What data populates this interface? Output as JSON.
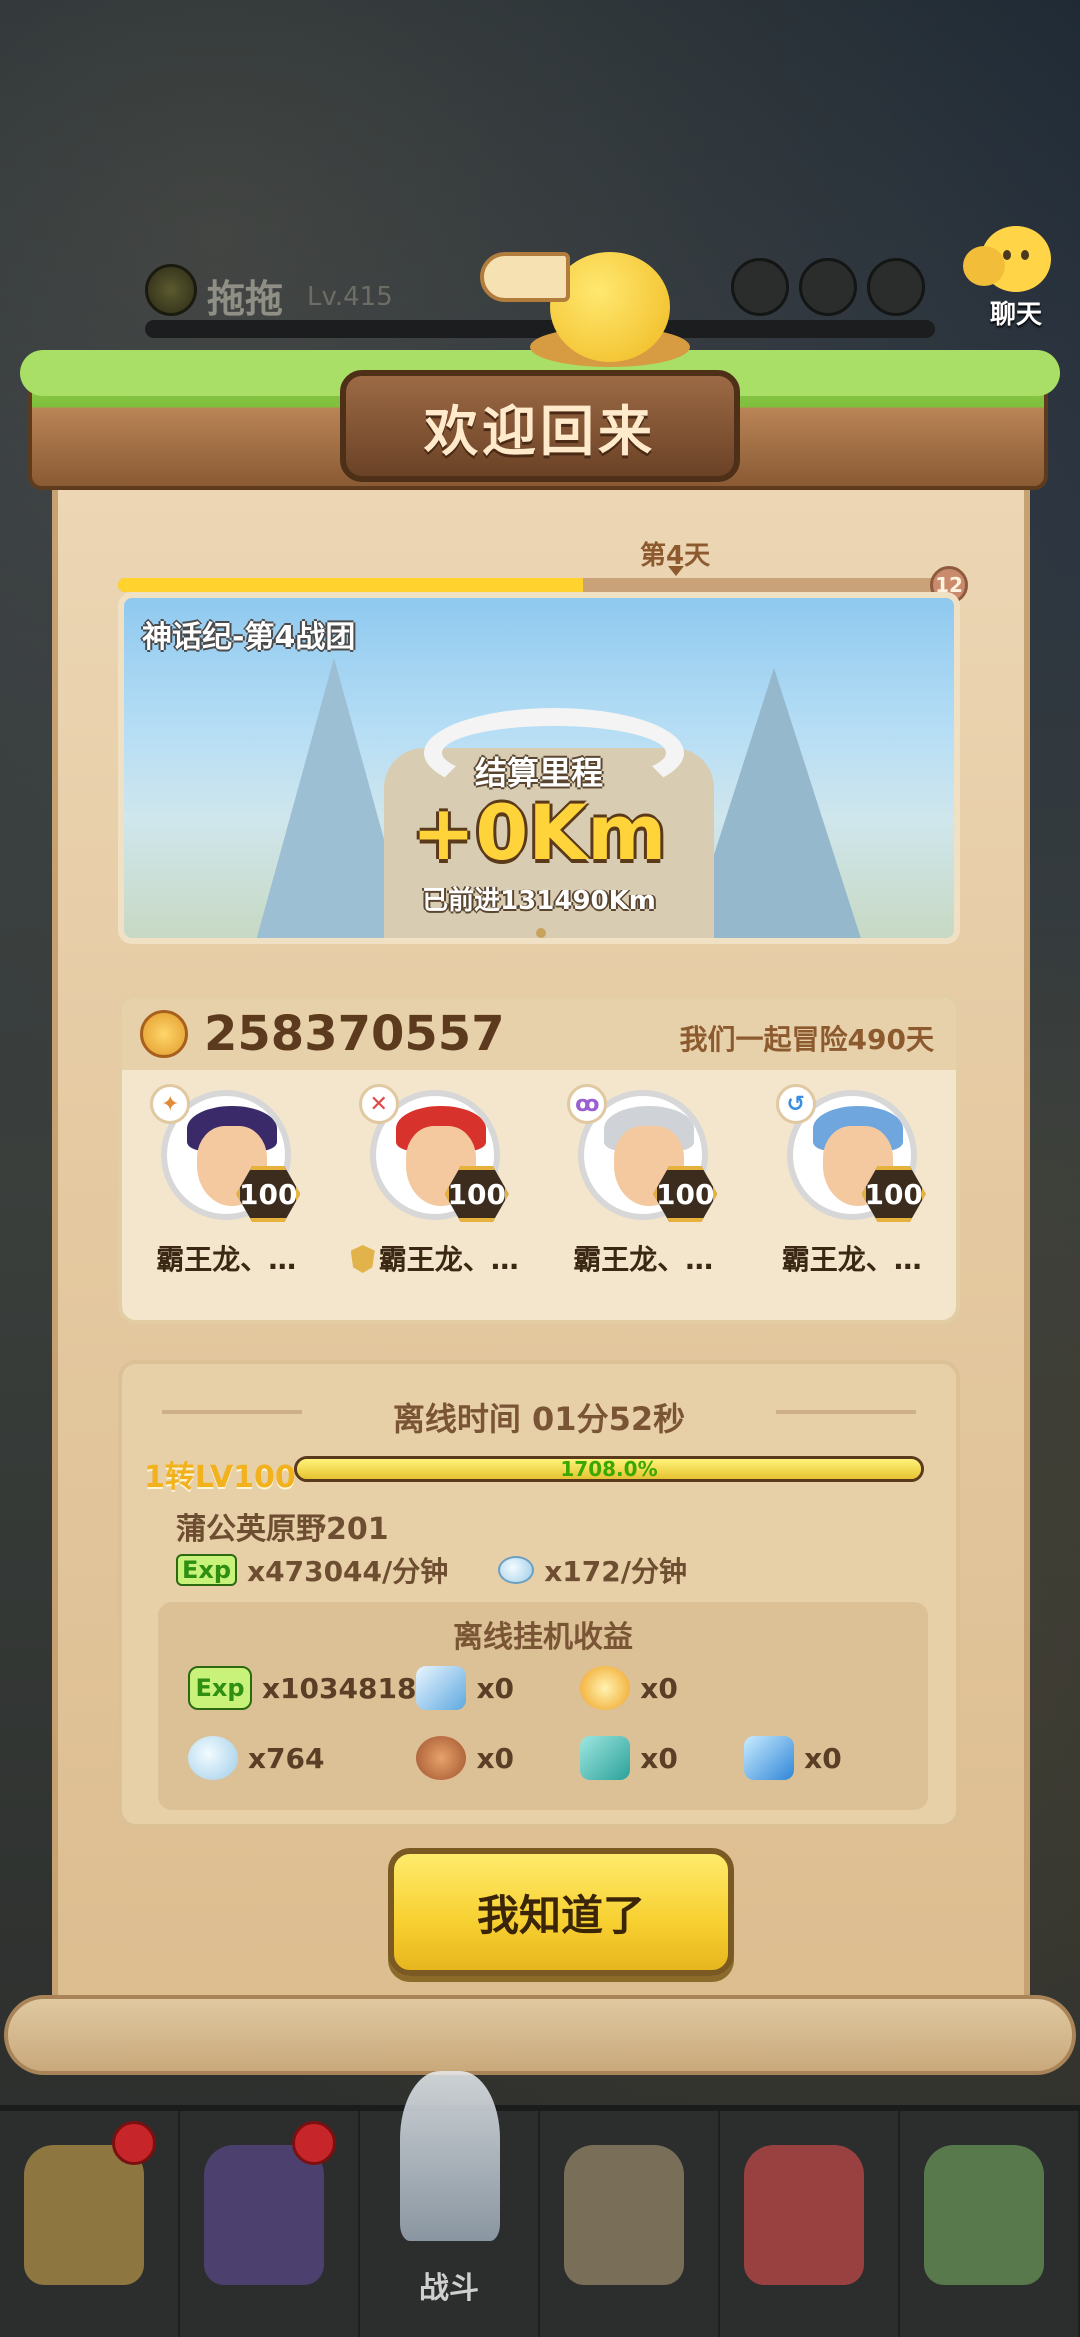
{
  "player": {
    "name": "拖拖",
    "level": "Lv.415"
  },
  "chat": {
    "label": "聊天",
    "icon": "chat-bubble-icon"
  },
  "dialog": {
    "title": "欢迎回来",
    "day_label": "第4天",
    "day_cap": "12",
    "day_progress": 0.567,
    "scene": {
      "team_name": "神话纪-第4战团",
      "settle_label": "结算里程",
      "distance_gain": "+0Km",
      "total_distance": "已前进131490Km"
    },
    "team": {
      "power": "258370557",
      "days_together": "我们一起冒险490天",
      "heroes": [
        {
          "name": "霸王龙、…",
          "level": "100",
          "element": "fire",
          "element_color": "#e08a3a"
        },
        {
          "name": "霸王龙、…",
          "level": "100",
          "element": "blood",
          "element_color": "#e04848",
          "has_shield": true
        },
        {
          "name": "霸王龙、…",
          "level": "100",
          "element": "void",
          "element_color": "#9a5fd0"
        },
        {
          "name": "霸王龙、…",
          "level": "100",
          "element": "water",
          "element_color": "#3a8ee0"
        }
      ]
    },
    "offline": {
      "title": "离线时间 01分52秒",
      "level_label": "1转LV100",
      "level_percent": "1708.0%",
      "map_name": "蒲公英原野201",
      "exp_rate_badge": "Exp",
      "exp_rate": "x473044/分钟",
      "gem_rate": "x172/分钟",
      "rewards_title": "离线挂机收益",
      "rewards": [
        {
          "icon": "exp-icon",
          "label": "Exp",
          "value": "x1034818"
        },
        {
          "icon": "ice-crystal-icon",
          "value": "x0"
        },
        {
          "icon": "flame-icon",
          "value": "x0"
        },
        {
          "icon": "gem-icon",
          "value": "x764"
        },
        {
          "icon": "meat-icon",
          "value": "x0"
        },
        {
          "icon": "teal-stone-icon",
          "value": "x0"
        },
        {
          "icon": "blue-crystal-icon",
          "value": "x0"
        }
      ]
    },
    "confirm_button": "我知道了"
  },
  "bottom_nav": {
    "center_label": "战斗"
  },
  "colors": {
    "accent_yellow": "#ffd22e",
    "parchment": "#ecd6b4",
    "wood": "#6b4226",
    "grass": "#9cd65c",
    "level_green": "#3aa800"
  }
}
